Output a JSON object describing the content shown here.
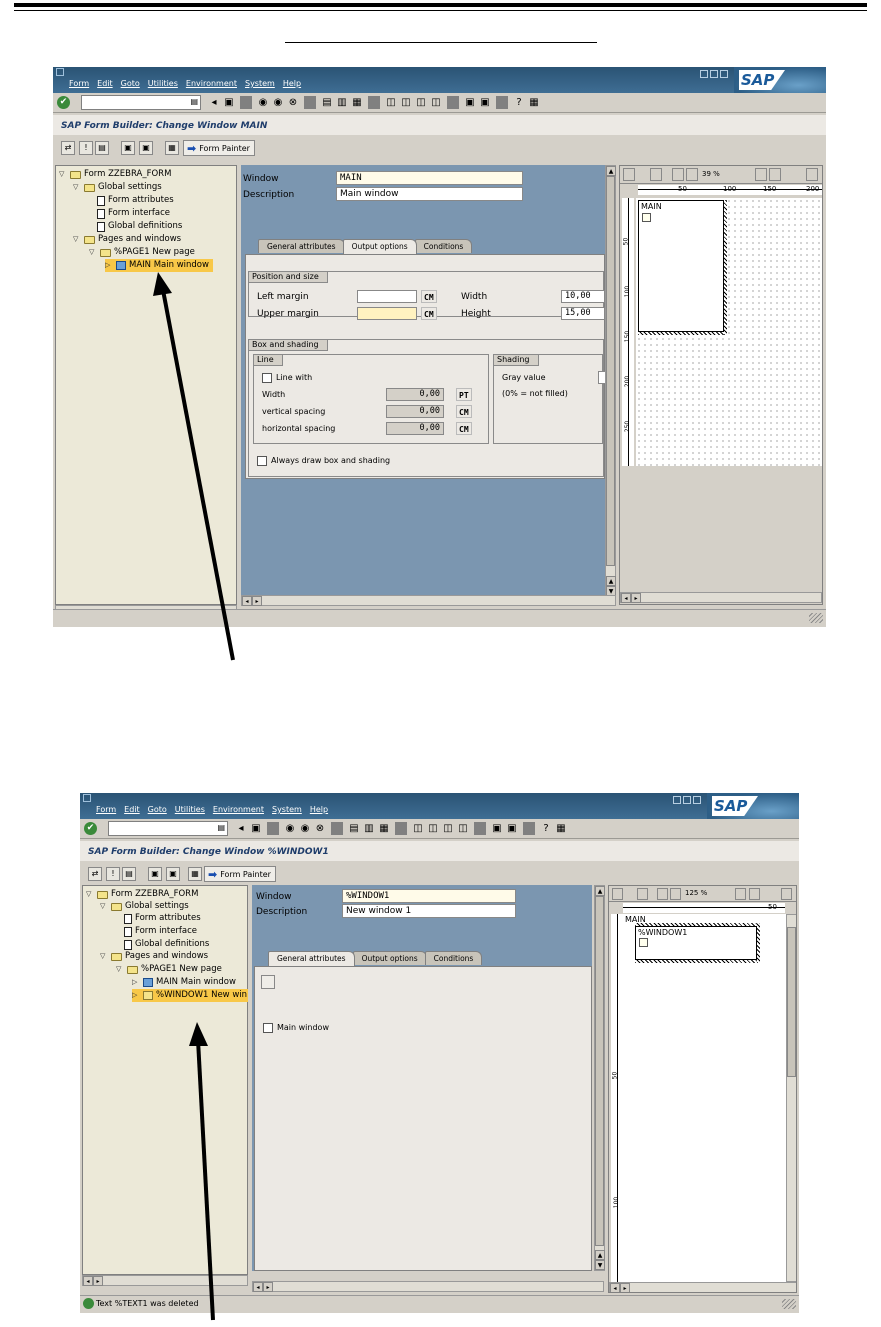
{
  "menu": {
    "items": [
      "Form",
      "Edit",
      "Goto",
      "Utilities",
      "Environment",
      "System",
      "Help"
    ]
  },
  "brand": "SAP",
  "shot1": {
    "title": "SAP Form Builder: Change Window MAIN",
    "form_painter_label": "Form Painter",
    "tree": [
      {
        "label": "Form ZZEBRA_FORM",
        "icon": "folder-icon"
      },
      {
        "label": "Global settings",
        "icon": "folder-icon"
      },
      {
        "label": "Form attributes",
        "icon": "document-icon"
      },
      {
        "label": "Form interface",
        "icon": "document-icon"
      },
      {
        "label": "Global definitions",
        "icon": "document-icon"
      },
      {
        "label": "Pages and windows",
        "icon": "folder-icon"
      },
      {
        "label": "%PAGE1 New page",
        "icon": "folder-icon"
      },
      {
        "label": "MAIN Main window",
        "icon": "window-icon"
      }
    ],
    "window_label": "Window",
    "window_value": "MAIN",
    "description_label": "Description",
    "description_value": "Main window",
    "tabs": [
      "General attributes",
      "Output options",
      "Conditions"
    ],
    "active_tab": "Output options",
    "position_group": "Position and size",
    "left_margin_label": "Left margin",
    "upper_margin_label": "Upper margin",
    "width_label": "Width",
    "height_label": "Height",
    "width_value": "10,00",
    "height_value": "15,00",
    "unit_cm": "CM",
    "unit_pt": "PT",
    "box_group": "Box and shading",
    "line_group": "Line",
    "line_with": "Line with",
    "line_width_label": "Width",
    "line_width_value": "0,00",
    "vspacing_label": "vertical spacing",
    "vspacing_value": "0,00",
    "hspacing_label": "horizontal spacing",
    "hspacing_value": "0,00",
    "shading_group": "Shading",
    "gray_value_label": "Gray value",
    "not_filled": "(0% = not filled)",
    "always_draw": "Always draw box and shading",
    "zoom": "39 %",
    "ruler_ticks": [
      "50",
      "100",
      "150",
      "200"
    ],
    "vruler_ticks": [
      "50",
      "100",
      "150",
      "200",
      "250"
    ],
    "painter_window": "MAIN"
  },
  "shot2": {
    "title": "SAP Form Builder: Change Window %WINDOW1",
    "form_painter_label": "Form Painter",
    "tree": [
      {
        "label": "Form ZZEBRA_FORM",
        "icon": "folder-icon"
      },
      {
        "label": "Global settings",
        "icon": "folder-icon"
      },
      {
        "label": "Form attributes",
        "icon": "document-icon"
      },
      {
        "label": "Form interface",
        "icon": "document-icon"
      },
      {
        "label": "Global definitions",
        "icon": "document-icon"
      },
      {
        "label": "Pages and windows",
        "icon": "folder-icon"
      },
      {
        "label": "%PAGE1 New page",
        "icon": "folder-icon"
      },
      {
        "label": "MAIN Main window",
        "icon": "window-icon"
      },
      {
        "label": "%WINDOW1 New win",
        "icon": "window-icon"
      }
    ],
    "window_label": "Window",
    "window_value": "%WINDOW1",
    "description_label": "Description",
    "description_value": "New window 1",
    "tabs": [
      "General attributes",
      "Output options",
      "Conditions"
    ],
    "active_tab": "General attributes",
    "main_window_label": "Main window",
    "zoom": "125 %",
    "ruler_tick": "50",
    "vruler_ticks": [
      "50",
      "100"
    ],
    "painter_main": "MAIN",
    "painter_window": "%WINDOW1",
    "status_message": "Text %TEXT1 was deleted"
  }
}
